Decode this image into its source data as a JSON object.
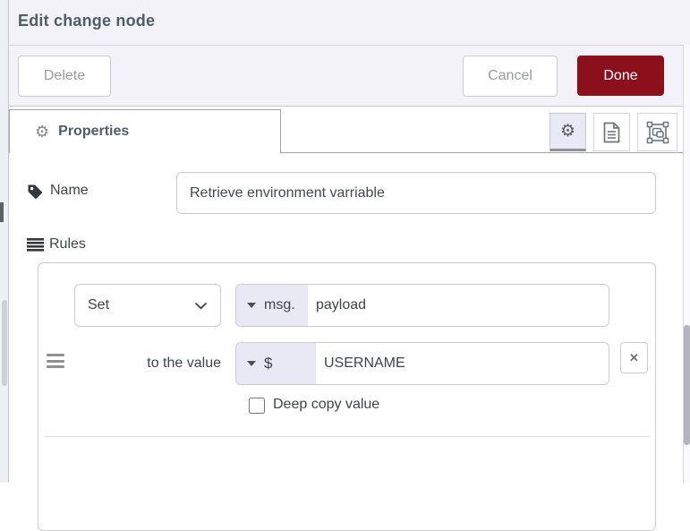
{
  "window": {
    "title": "Edit change node"
  },
  "toolbar": {
    "delete_label": "Delete",
    "cancel_label": "Cancel",
    "done_label": "Done"
  },
  "tabs": {
    "properties_label": "Properties"
  },
  "form": {
    "name_label": "Name",
    "name_value": "Retrieve environment varriable",
    "rules_label": "Rules"
  },
  "rule": {
    "action_selected": "Set",
    "property_prefix": "msg.",
    "property_value": "payload",
    "to_label": "to the value",
    "value_prefix": "$",
    "value_text": "USERNAME",
    "deep_copy_label": "Deep copy value",
    "deep_copy_checked": false,
    "delete_icon": "✕"
  },
  "icons": {
    "gear": "⚙",
    "tab_gear": "⚙"
  },
  "colors": {
    "accent_red": "#8C101C",
    "header_bg": "#f2f2f8",
    "title_text": "#4e5d68",
    "typed_label_bg": "#e8e9f5",
    "border_gray": "#cccccc"
  }
}
